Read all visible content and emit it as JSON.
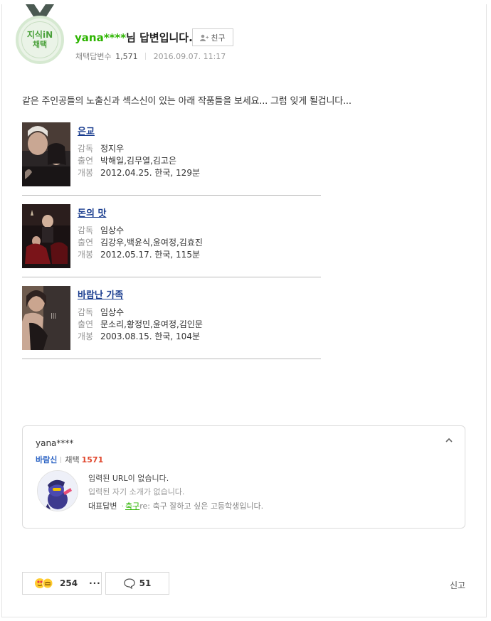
{
  "header": {
    "badge_line1": "지식iN",
    "badge_line2": "채택",
    "username": "yana****",
    "title_suffix": "님 답변입니다.",
    "friend_label": "친구",
    "adopted_label": "채택답변수",
    "adopted_count": "1,571",
    "date": "2016.09.07. 11:17"
  },
  "answer": {
    "text": "같은 주인공들의 노출신과 섹스신이 있는 아래 작품들을 보세요... 그럼 잊게 될겁니다..."
  },
  "movies": [
    {
      "title": "은교",
      "director_label": "감독",
      "director": "정지우",
      "cast_label": "출연",
      "cast": "박해일,김무열,김고은",
      "release_label": "개봉",
      "release": "2012.04.25. 한국, 129분"
    },
    {
      "title": "돈의 맛",
      "director_label": "감독",
      "director": "임상수",
      "cast_label": "출연",
      "cast": "김강우,백윤식,윤여정,김효진",
      "release_label": "개봉",
      "release": "2012.05.17. 한국, 115분"
    },
    {
      "title": "바람난 가족",
      "director_label": "감독",
      "director": "임상수",
      "cast_label": "출연",
      "cast": "문소리,황정민,윤여정,김인문",
      "release_label": "개봉",
      "release": "2003.08.15. 한국, 104분"
    }
  ],
  "profile": {
    "name": "yana****",
    "grade": "바람신",
    "adopted_label": "채택",
    "adopted_count": "1571",
    "url_text": "입력된 URL이 없습니다.",
    "intro_text": "입력된 자기 소개가 없습니다.",
    "rep_label": "대표답변",
    "rep_category": "축구",
    "rep_text": "re: 축구 잘하고 싶은 고등학생입니다."
  },
  "footer": {
    "reaction_count": "254",
    "more_label": "···",
    "comment_count": "51",
    "report_label": "신고"
  },
  "colors": {
    "accent_green": "#2db400",
    "link_blue": "#1a3d8f",
    "grade_blue": "#2b63c4",
    "count_red": "#e0462c"
  }
}
